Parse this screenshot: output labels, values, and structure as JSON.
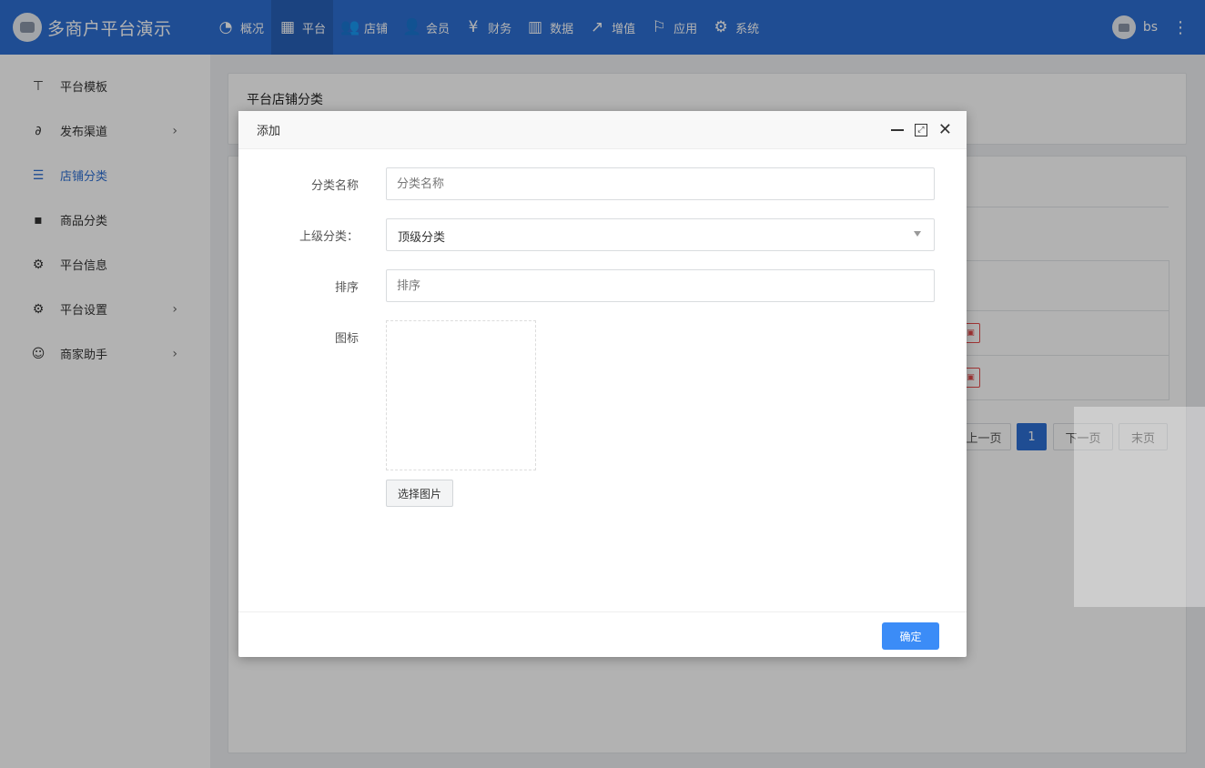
{
  "app": {
    "title": "多商户平台演示"
  },
  "nav": {
    "items": [
      {
        "label": "概况",
        "icon": "dashboard-icon"
      },
      {
        "label": "平台",
        "icon": "grid-icon",
        "active": true
      },
      {
        "label": "店铺",
        "icon": "users-icon"
      },
      {
        "label": "会员",
        "icon": "user-plus-icon"
      },
      {
        "label": "财务",
        "icon": "yen-icon"
      },
      {
        "label": "数据",
        "icon": "bar-chart-icon"
      },
      {
        "label": "增值",
        "icon": "line-chart-icon"
      },
      {
        "label": "应用",
        "icon": "flag-icon"
      },
      {
        "label": "系统",
        "icon": "gear-icon"
      }
    ]
  },
  "user": {
    "name": "bs"
  },
  "sidebar": {
    "items": [
      {
        "label": "平台模板",
        "icon": "paint-roller-icon",
        "has_arrow": false
      },
      {
        "label": "发布渠道",
        "icon": "link-icon",
        "has_arrow": true
      },
      {
        "label": "店铺分类",
        "icon": "list-icon",
        "has_arrow": false,
        "active": true
      },
      {
        "label": "商品分类",
        "icon": "apps-icon",
        "has_arrow": false
      },
      {
        "label": "平台信息",
        "icon": "gear-icon",
        "has_arrow": false
      },
      {
        "label": "平台设置",
        "icon": "gear-icon",
        "has_arrow": true
      },
      {
        "label": "商家助手",
        "icon": "smile-box-icon",
        "has_arrow": true
      }
    ]
  },
  "page": {
    "title": "平台店铺分类"
  },
  "pagination": {
    "prev": "上一页",
    "current": "1",
    "next": "下一页",
    "last": "末页"
  },
  "modal": {
    "title": "添加",
    "fields": {
      "name": {
        "label": "分类名称",
        "placeholder": "分类名称",
        "value": ""
      },
      "parent": {
        "label": "上级分类：",
        "value": "顶级分类"
      },
      "sort": {
        "label": "排序",
        "placeholder": "排序",
        "value": ""
      },
      "icon": {
        "label": "图标",
        "button": "选择图片"
      }
    },
    "confirm": "确定"
  },
  "colors": {
    "primary": "#2d6fd3",
    "confirm": "#3b8cf7",
    "danger": "#e64b4b"
  }
}
